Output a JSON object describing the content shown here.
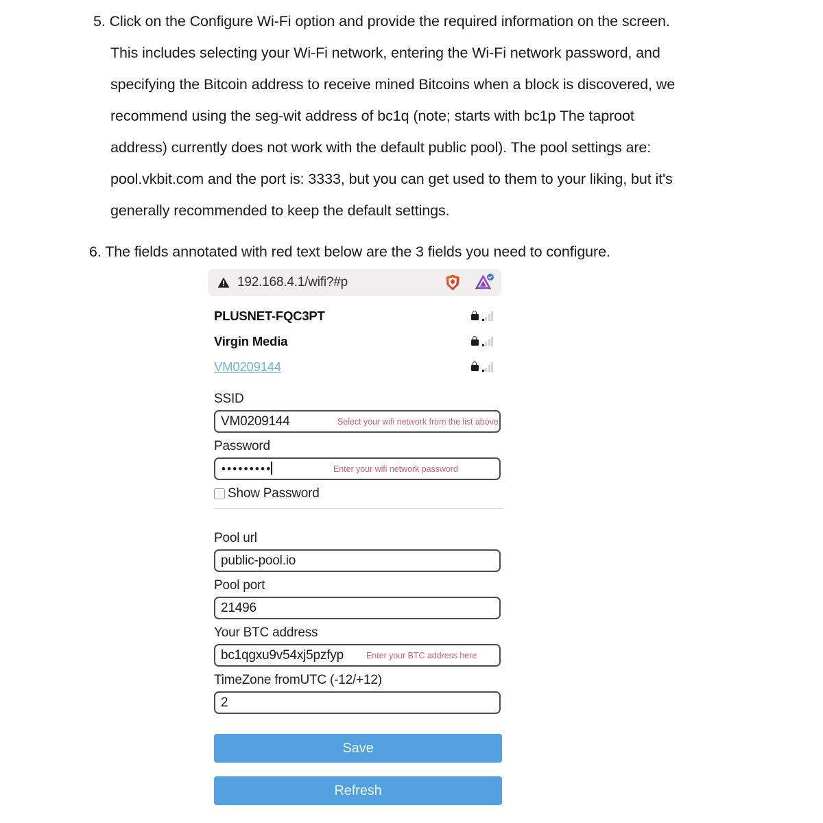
{
  "document": {
    "step5": "5. Click on the Configure Wi-Fi option and provide the required information on the screen. This includes selecting your Wi-Fi network, entering the Wi-Fi network password, and specifying the Bitcoin address to receive mined Bitcoins when a block is discovered, we recommend using the seg-wit address of bc1q (note; starts with bc1p The taproot address) currently does not work with the default public pool). The pool settings are: pool.vkbit.com and the port is: 3333, but you can get used to them to your liking, but it's generally recommended to keep the default settings.",
    "step6": "6.  The fields annotated with red text below are the 3 fields you need to configure."
  },
  "browser": {
    "warning_icon": "warning-triangle-icon",
    "url": "192.168.4.1/wifi?#p",
    "brave_icon": "brave-shield-icon",
    "extension_icon": "extension-triangle-icon"
  },
  "wifi_list": [
    {
      "ssid": "PLUSNET-FQC3PT",
      "secured": true,
      "selected": false
    },
    {
      "ssid": "Virgin Media",
      "secured": true,
      "selected": false
    },
    {
      "ssid": "VM0209144",
      "secured": true,
      "selected": true
    }
  ],
  "form": {
    "ssid": {
      "label": "SSID",
      "value": "VM0209144",
      "hint": "Select your wifi network from the list above"
    },
    "password": {
      "label": "Password",
      "value": "•••••••••",
      "hint": "Enter your wifi network password"
    },
    "show_password": {
      "label": "Show Password",
      "checked": false
    },
    "pool_url": {
      "label": "Pool url",
      "value": "public-pool.io"
    },
    "pool_port": {
      "label": "Pool port",
      "value": "21496"
    },
    "btc_address": {
      "label": "Your BTC address",
      "value": "bc1qgxu9v54xj5pzfyp",
      "hint": "Enter your BTC address here"
    },
    "timezone": {
      "label": "TimeZone fromUTC (-12/+12)",
      "value": "2"
    },
    "save_button": "Save",
    "refresh_button": "Refresh"
  },
  "colors": {
    "button_blue": "#52a0e0",
    "hint_red": "#c9656d",
    "link_blue": "#6fb3e0",
    "urlbar_bg": "#f1efee"
  }
}
